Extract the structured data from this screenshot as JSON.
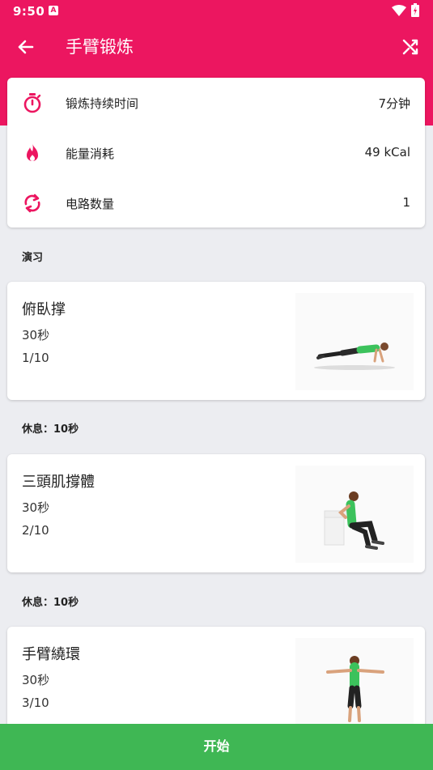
{
  "status": {
    "time": "9:50",
    "notif_letter": "A"
  },
  "toolbar": {
    "title": "手臂锻炼",
    "back_icon": "arrow-left-icon",
    "shuffle_icon": "shuffle-icon"
  },
  "summary": [
    {
      "icon": "stopwatch-icon",
      "label": "锻炼持续时间",
      "value": "7分钟"
    },
    {
      "icon": "flame-icon",
      "label": "能量消耗",
      "value": "49 kCal"
    },
    {
      "icon": "repeat-icon",
      "label": "电路数量",
      "value": "1"
    }
  ],
  "section_label": "演习",
  "rest_label": "休息：",
  "exercises": [
    {
      "name": "俯臥撑",
      "duration": "30秒",
      "index": "1/10",
      "rest_after": "10秒"
    },
    {
      "name": "三頭肌撐體",
      "duration": "30秒",
      "index": "2/10",
      "rest_after": "10秒"
    },
    {
      "name": "手臂繞環",
      "duration": "30秒",
      "index": "3/10"
    }
  ],
  "start_button": "开始",
  "colors": {
    "accent": "#EC1660",
    "start": "#3FB754",
    "background": "#ECEDF1"
  }
}
